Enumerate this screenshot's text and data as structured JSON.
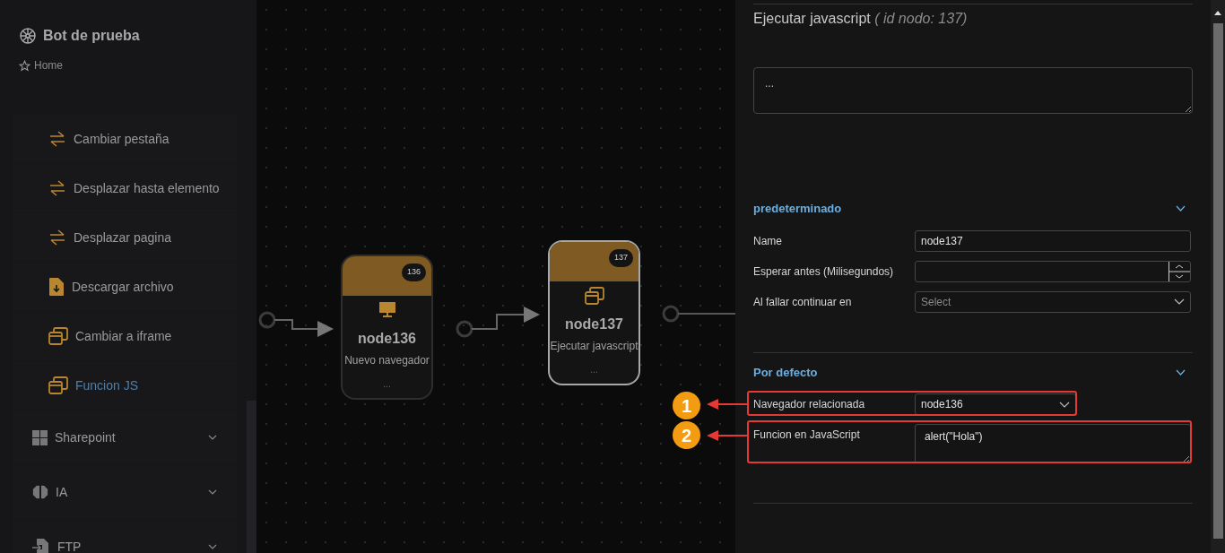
{
  "sidebar": {
    "title": "Bot de prueba",
    "breadcrumb": "Home",
    "items": [
      {
        "label": "Cambiar pestaña",
        "kind": "sub",
        "selected": false
      },
      {
        "label": "Desplazar hasta elemento",
        "kind": "sub",
        "selected": false
      },
      {
        "label": "Desplazar pagina",
        "kind": "sub",
        "selected": false
      },
      {
        "label": "Descargar archivo",
        "kind": "sub",
        "selected": false
      },
      {
        "label": "Cambiar a iframe",
        "kind": "sub",
        "selected": false
      },
      {
        "label": "Funcion JS",
        "kind": "sub",
        "selected": true
      },
      {
        "label": "Sharepoint",
        "kind": "group",
        "expanded": false
      },
      {
        "label": "IA",
        "kind": "group",
        "expanded": false
      },
      {
        "label": "FTP",
        "kind": "group",
        "expanded": false
      }
    ]
  },
  "canvas": {
    "nodes": [
      {
        "badge": "136",
        "name": "node136",
        "type": "Nuevo navegador",
        "extra": "...",
        "selected": false
      },
      {
        "badge": "137",
        "name": "node137",
        "type": "Ejecutar javascript",
        "extra": "...",
        "selected": true
      }
    ]
  },
  "panel": {
    "title": "Ejecutar javascript",
    "subtitle": "( id nodo: 137)",
    "description": "...",
    "sections": [
      {
        "title": "predeterminado",
        "expanded": true,
        "fields": [
          {
            "kind": "text",
            "label": "Name",
            "value": "node137"
          },
          {
            "kind": "number",
            "label": "Esperar antes (Milisegundos)"
          },
          {
            "kind": "select",
            "label": "Al fallar continuar en",
            "placeholder": "Select"
          }
        ]
      },
      {
        "title": "Por defecto",
        "expanded": true,
        "fields": [
          {
            "kind": "select",
            "label": "Navegador relacionada",
            "value": "node136",
            "annotation": "1"
          },
          {
            "kind": "textarea",
            "label": "Funcion en JavaScript",
            "value": "alert(\"Hola\")",
            "annotation": "2"
          }
        ]
      }
    ]
  }
}
